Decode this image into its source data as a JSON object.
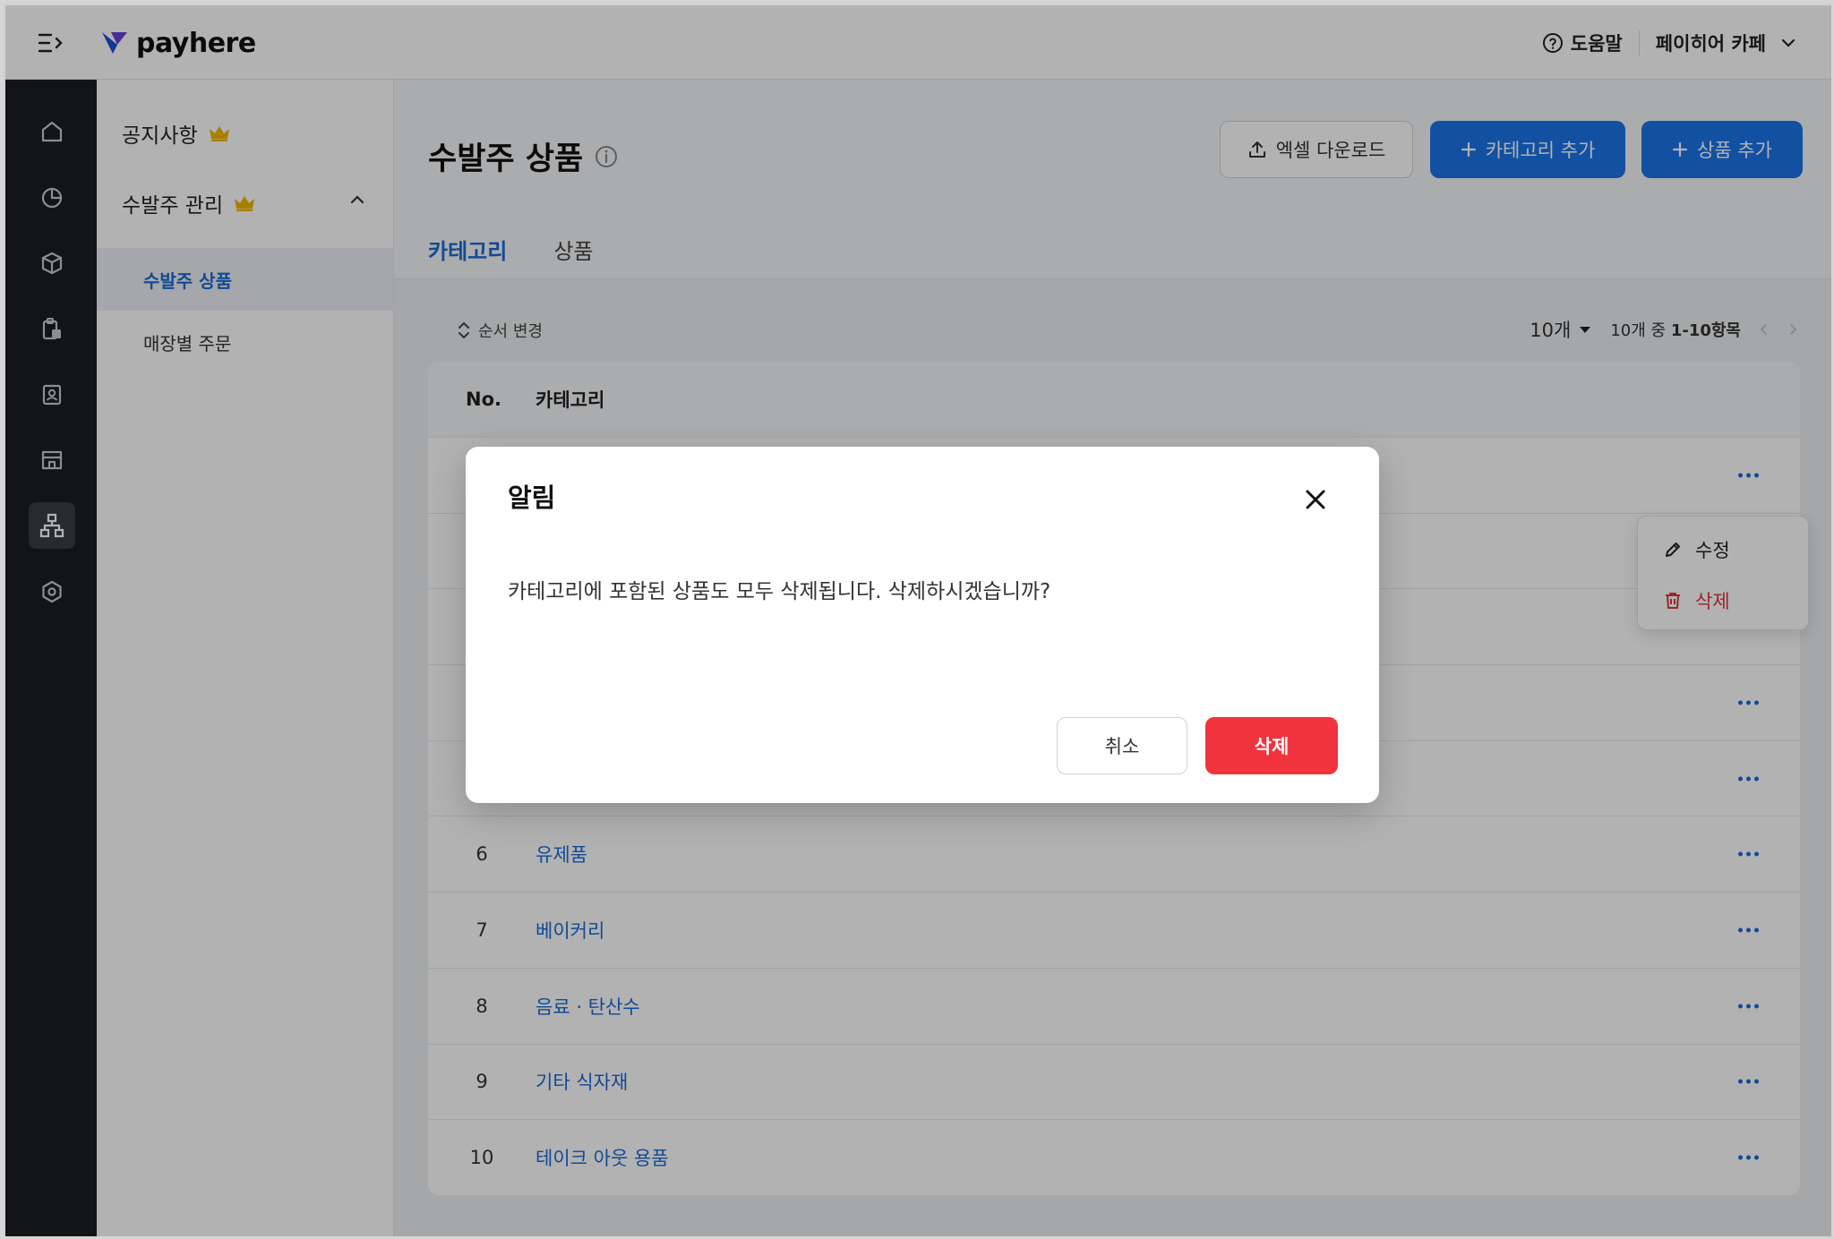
{
  "header": {
    "brand": "payhere",
    "help_label": "도움말",
    "store_name": "페이히어 카페"
  },
  "rail": {
    "items": [
      "home-icon",
      "chart-pie-icon",
      "box-icon",
      "clipboard-icon",
      "contact-card-icon",
      "store-icon",
      "hierarchy-icon",
      "settings-icon"
    ],
    "active": "hierarchy-icon"
  },
  "subnav": {
    "notice": "공지사항",
    "order_management": "수발주 관리",
    "items": [
      {
        "label": "수발주 상품",
        "active": true
      },
      {
        "label": "매장별 주문",
        "active": false
      }
    ]
  },
  "page": {
    "title": "수발주 상품",
    "excel_download": "엑셀 다운로드",
    "add_category": "카테고리 추가",
    "add_product": "상품 추가"
  },
  "tabs": [
    {
      "label": "카테고리",
      "active": true
    },
    {
      "label": "상품",
      "active": false
    }
  ],
  "toolbar": {
    "reorder": "순서 변경",
    "page_size": "10개",
    "range_prefix": "10개 중",
    "range_value": "1-10항목"
  },
  "table": {
    "columns": [
      "No.",
      "카테고리"
    ],
    "rows": [
      {
        "no": "",
        "category": ""
      },
      {
        "no": "",
        "category": ""
      },
      {
        "no": "",
        "category": ""
      },
      {
        "no": "",
        "category": ""
      },
      {
        "no": "",
        "category": ""
      },
      {
        "no": "6",
        "category": "유제품"
      },
      {
        "no": "7",
        "category": "베이커리"
      },
      {
        "no": "8",
        "category": "음료 · 탄산수"
      },
      {
        "no": "9",
        "category": "기타 식자재"
      },
      {
        "no": "10",
        "category": "테이크 아웃 용품"
      }
    ]
  },
  "row_menu": {
    "edit": "수정",
    "delete": "삭제"
  },
  "modal": {
    "title": "알림",
    "message": "카테고리에 포함된 상품도 모두 삭제됩니다. 삭제하시겠습니까?",
    "cancel": "취소",
    "confirm": "삭제"
  },
  "colors": {
    "primary": "#1a73e8",
    "danger": "#f0333d",
    "rail_bg": "#1b1d22",
    "crown": "#f2b705"
  }
}
